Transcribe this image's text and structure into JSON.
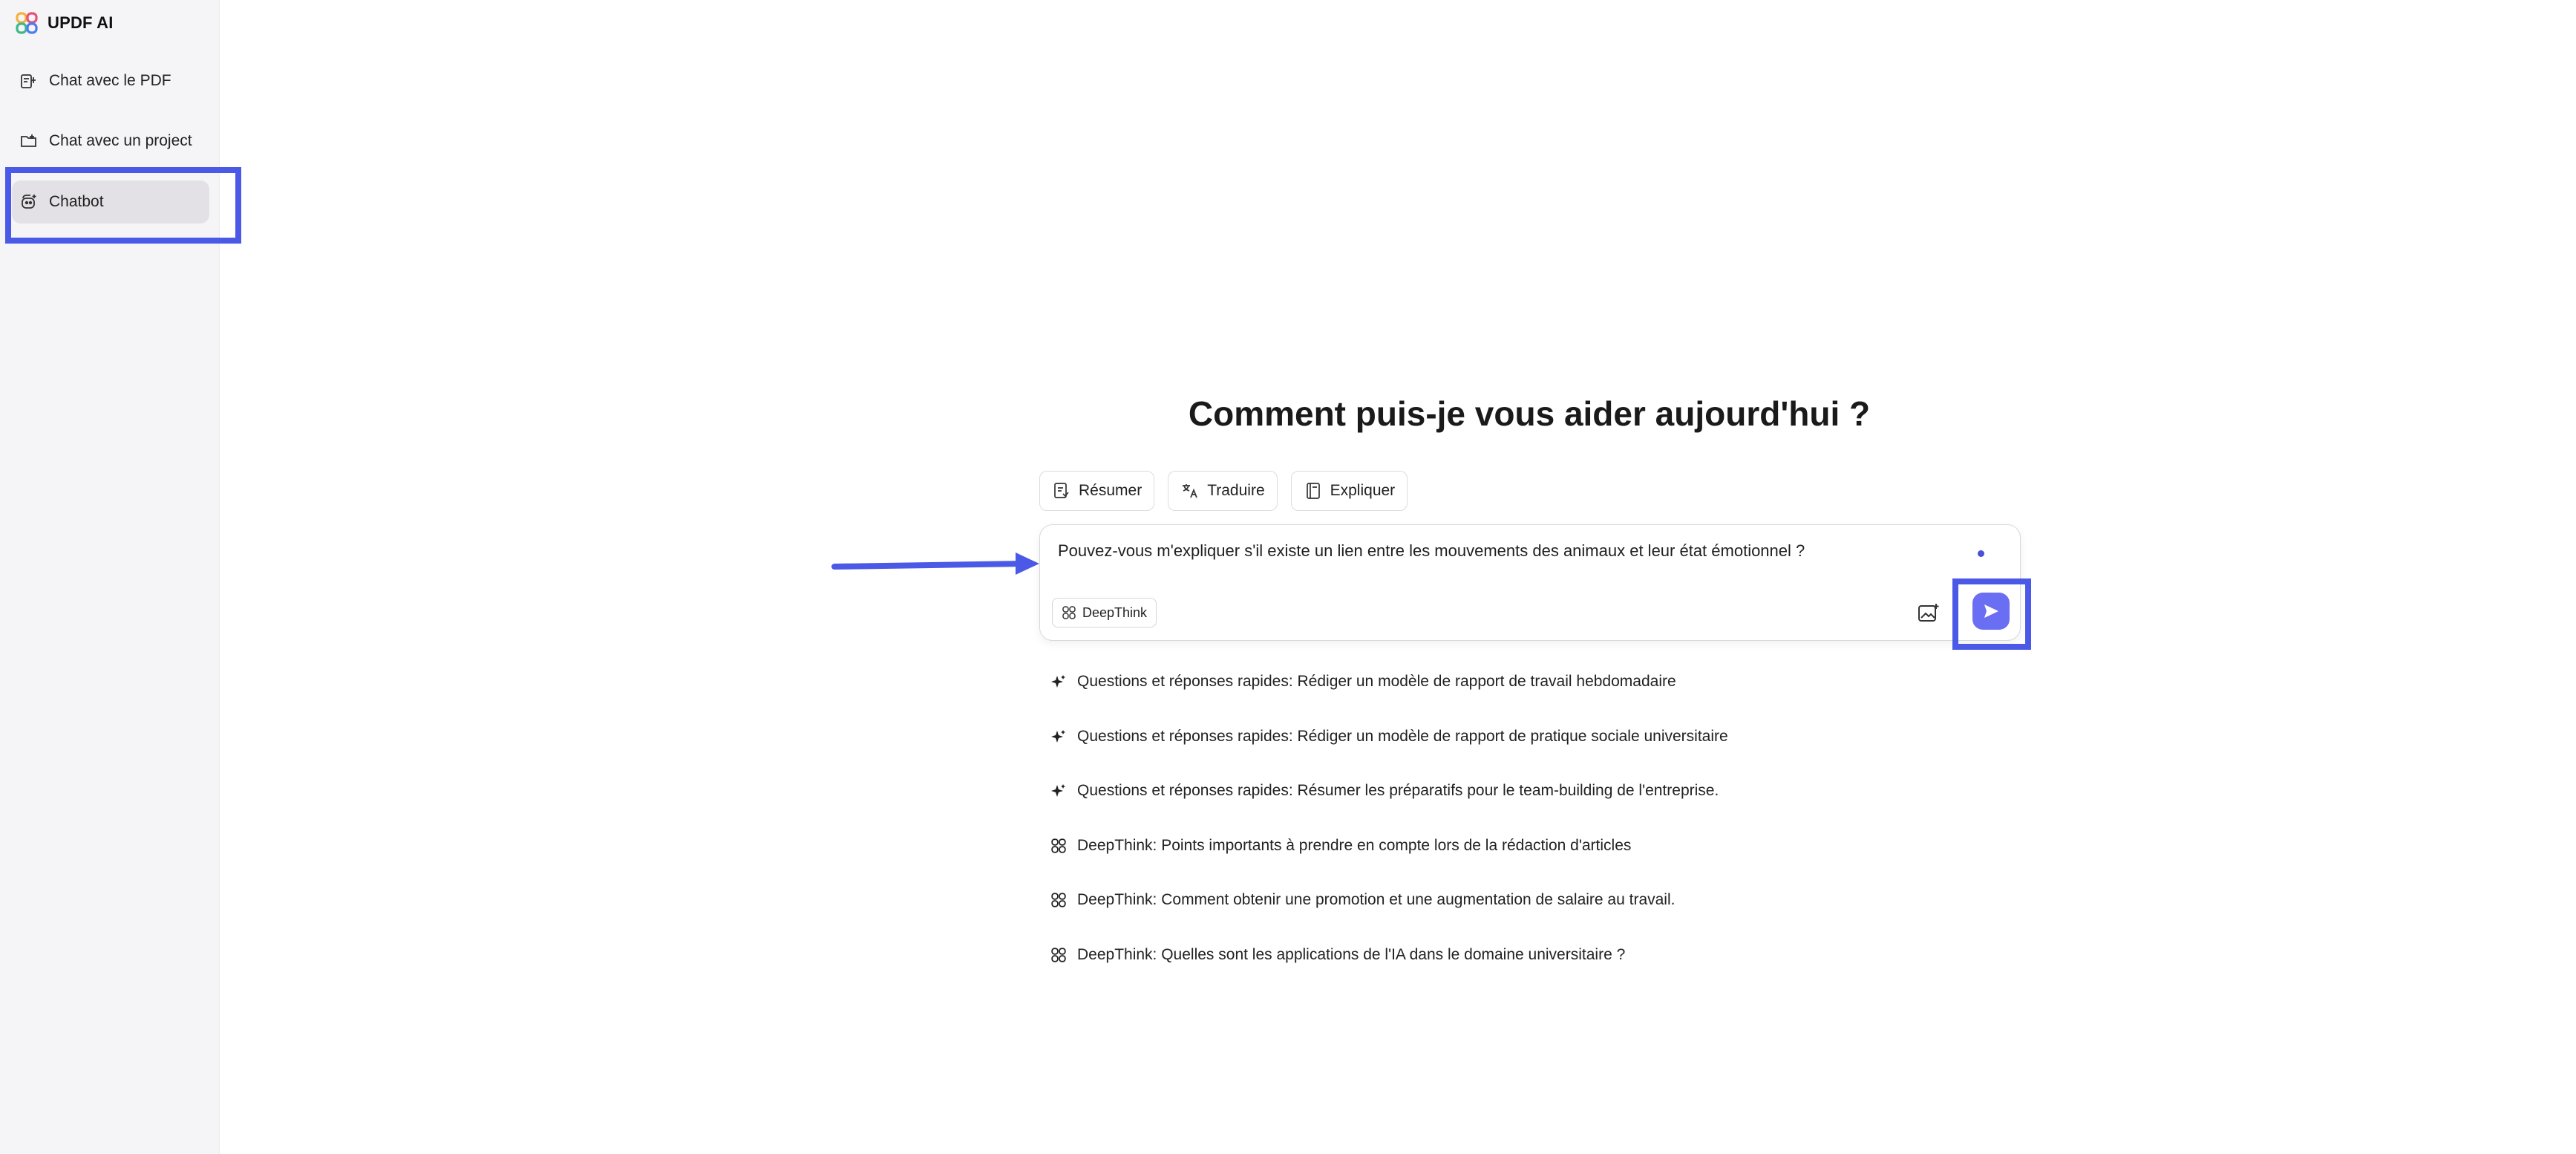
{
  "brand": {
    "name": "UPDF AI",
    "icon": "updf-logo-icon"
  },
  "sidebar": {
    "items": [
      {
        "label": "Chat avec le PDF",
        "icon": "pdf-chat-icon",
        "active": false
      },
      {
        "label": "Chat avec un project",
        "icon": "folder-icon",
        "active": false
      },
      {
        "label": "Chatbot",
        "icon": "chatbot-icon",
        "active": true
      }
    ]
  },
  "main": {
    "heading": "Comment puis-je vous aider aujourd'hui ?",
    "chips": [
      {
        "label": "Résumer",
        "icon": "summarize-icon"
      },
      {
        "label": "Traduire",
        "icon": "translate-icon"
      },
      {
        "label": "Expliquer",
        "icon": "book-icon"
      }
    ],
    "composer": {
      "value": "Pouvez-vous m'expliquer s'il existe un lien entre les mouvements des animaux et leur état émotionnel ?",
      "deepthink_label": "DeepThink"
    },
    "suggestions": [
      {
        "text": "Questions et réponses rapides: Rédiger un modèle de rapport de travail hebdomadaire",
        "icon": "sparkle-icon"
      },
      {
        "text": "Questions et réponses rapides: Rédiger un modèle de rapport de pratique sociale universitaire",
        "icon": "sparkle-icon"
      },
      {
        "text": "Questions et réponses rapides: Résumer les préparatifs pour le team-building de l'entreprise.",
        "icon": "sparkle-icon"
      },
      {
        "text": "DeepThink: Points importants à prendre en compte lors de la rédaction d'articles",
        "icon": "deepthink-icon"
      },
      {
        "text": "DeepThink: Comment obtenir une promotion et une augmentation de salaire au travail.",
        "icon": "deepthink-icon"
      },
      {
        "text": "DeepThink: Quelles sont les applications de l'IA dans le domaine universitaire ?",
        "icon": "deepthink-icon"
      }
    ]
  },
  "colors": {
    "accent": "#6a6ef2",
    "annotation": "#4b5ae6",
    "sidebar_bg": "#f5f4f7"
  }
}
